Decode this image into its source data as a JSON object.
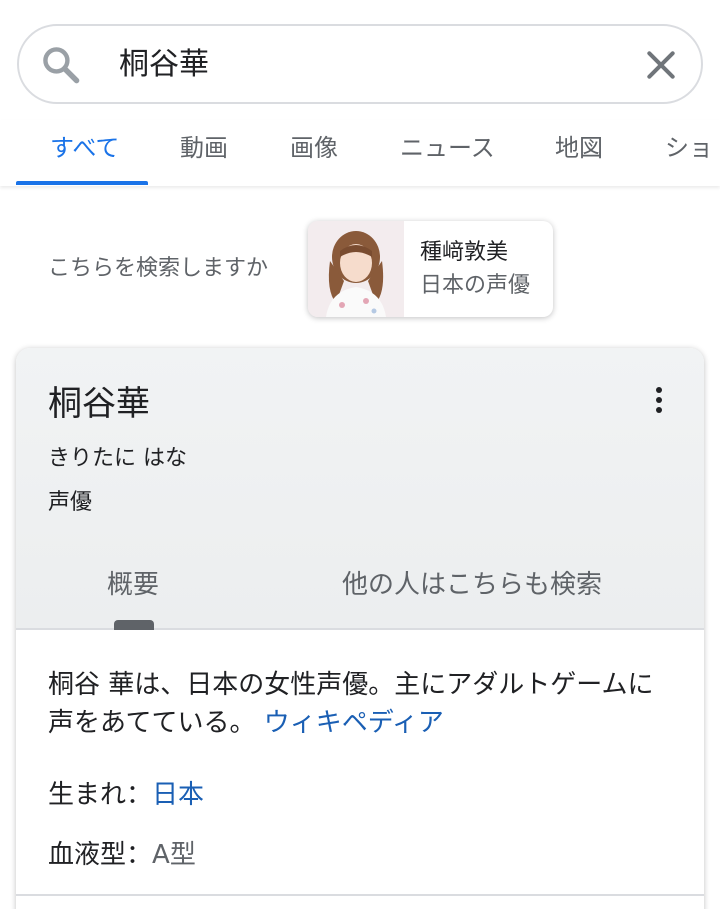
{
  "search": {
    "query": "桐谷華"
  },
  "tabs": [
    "すべて",
    "動画",
    "画像",
    "ニュース",
    "地図",
    "ショ"
  ],
  "did_you_mean": {
    "label": "こちらを検索しますか",
    "name": "種﨑敦美",
    "description": "日本の声優"
  },
  "panel": {
    "title": "桐谷華",
    "reading": "きりたに はな",
    "type": "声優",
    "tabs": [
      "概要",
      "他の人はこちらも検索"
    ],
    "description": "桐谷 華は、日本の女性声優。主にアダルトゲームに声をあてている。",
    "source_link": "ウィキペディア",
    "facts": [
      {
        "label": "生まれ",
        "value": "日本"
      },
      {
        "label": "血液型",
        "value": "A型"
      }
    ]
  },
  "colors": {
    "accent": "#1a73e8",
    "link": "#1a5fb4",
    "muted": "#5f6368"
  }
}
